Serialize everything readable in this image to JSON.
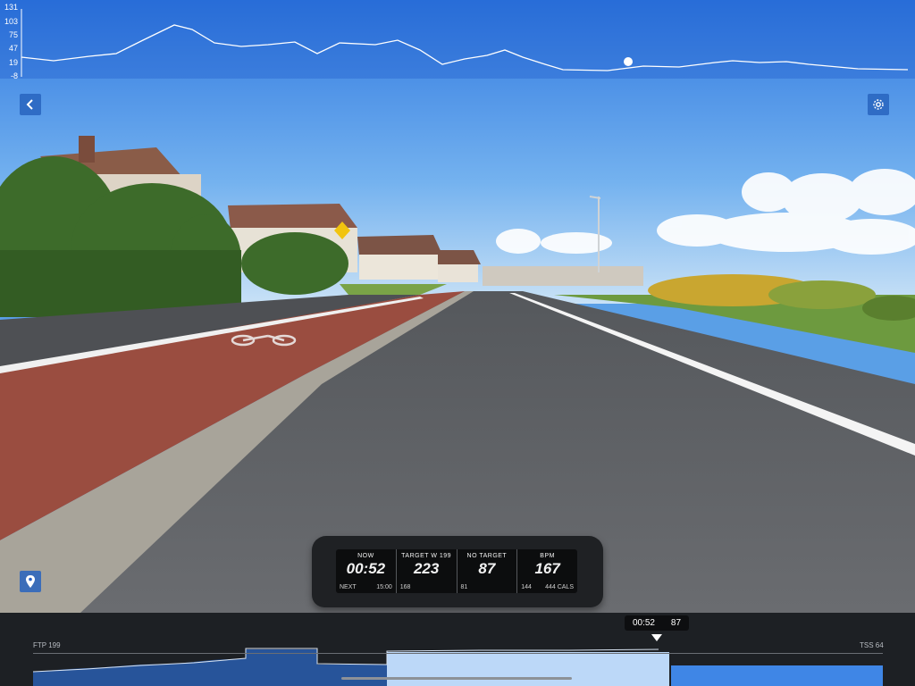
{
  "elevation": {
    "axis_labels": [
      "131",
      "103",
      "75",
      "47",
      "19",
      "-8"
    ]
  },
  "icons": {
    "back": "chevron-left-icon",
    "settings": "gear-icon",
    "map": "map-pin-icon"
  },
  "hud": {
    "now": {
      "label": "NOW",
      "value": "00:52",
      "next_label": "NEXT",
      "next_value": "15:00"
    },
    "power": {
      "label": "TARGET W 199",
      "value": "223",
      "sub": "168"
    },
    "cadence": {
      "label": "NO TARGET",
      "value": "87",
      "sub": "81"
    },
    "heart": {
      "label": "BPM",
      "value": "167",
      "sub": "144",
      "calories": "444 CALS"
    }
  },
  "timeline": {
    "ftp_label": "FTP 199",
    "tss_label": "TSS 64",
    "current_time": "00:52",
    "current_value": "87"
  },
  "colors": {
    "sky": "#5a9fe6",
    "accent_blue": "#2a62c8",
    "segment_dark": "#27549a",
    "segment_light": "#bcd8f8",
    "segment_mid": "#3f86e6"
  }
}
